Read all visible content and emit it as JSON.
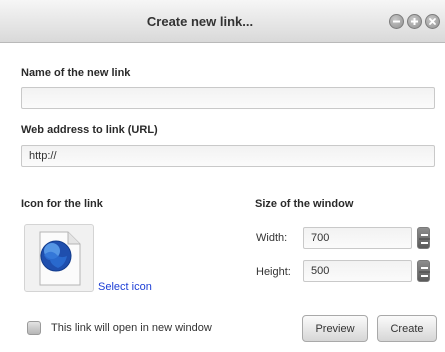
{
  "window": {
    "title": "Create new link...",
    "controls": [
      "minimize-icon",
      "maximize-icon",
      "close-icon"
    ]
  },
  "name_section": {
    "label": "Name of the new link",
    "value": ""
  },
  "url_section": {
    "label": "Web address to link (URL)",
    "value": "http://"
  },
  "icon_section": {
    "label": "Icon for the link",
    "icon": "globe-document-icon",
    "select_label": "Select icon"
  },
  "size_section": {
    "label": "Size of the window",
    "width_label": "Width:",
    "width_value": "700",
    "height_label": "Height:",
    "height_value": "500"
  },
  "new_window": {
    "checked": false,
    "label": "This link will open in new window"
  },
  "buttons": {
    "preview": "Preview",
    "create": "Create"
  },
  "colors": {
    "link": "#1c3ed6"
  }
}
